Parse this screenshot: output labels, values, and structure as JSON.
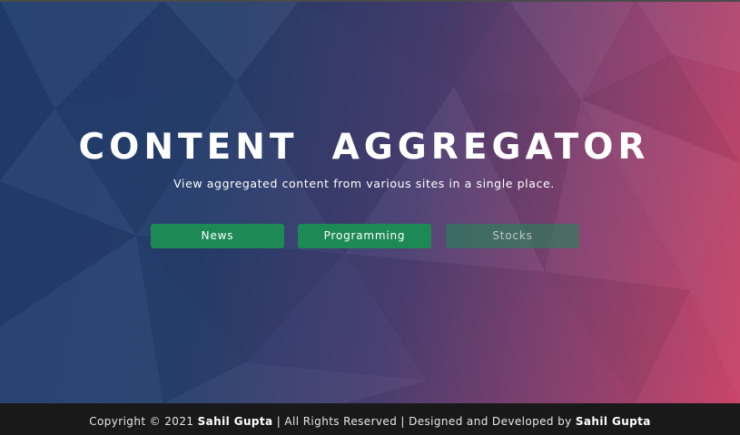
{
  "hero": {
    "title": "CONTENT  AGGREGATOR",
    "subtitle": "View aggregated content from various sites in a single place."
  },
  "buttons": [
    {
      "label": "News",
      "enabled": true
    },
    {
      "label": "Programming",
      "enabled": true
    },
    {
      "label": "Stocks",
      "enabled": false
    }
  ],
  "footer": {
    "copyright_prefix": "Copyright © 2021",
    "author_name": "Sahil Gupta",
    "rights_text": "| All Rights Reserved | Designed and Developed by",
    "developer_name": "Sahil Gupta"
  },
  "colors": {
    "button": "#1d8a55",
    "footer_bg": "#191919",
    "gradient_left": "#223e6f",
    "gradient_right": "#c94468"
  }
}
